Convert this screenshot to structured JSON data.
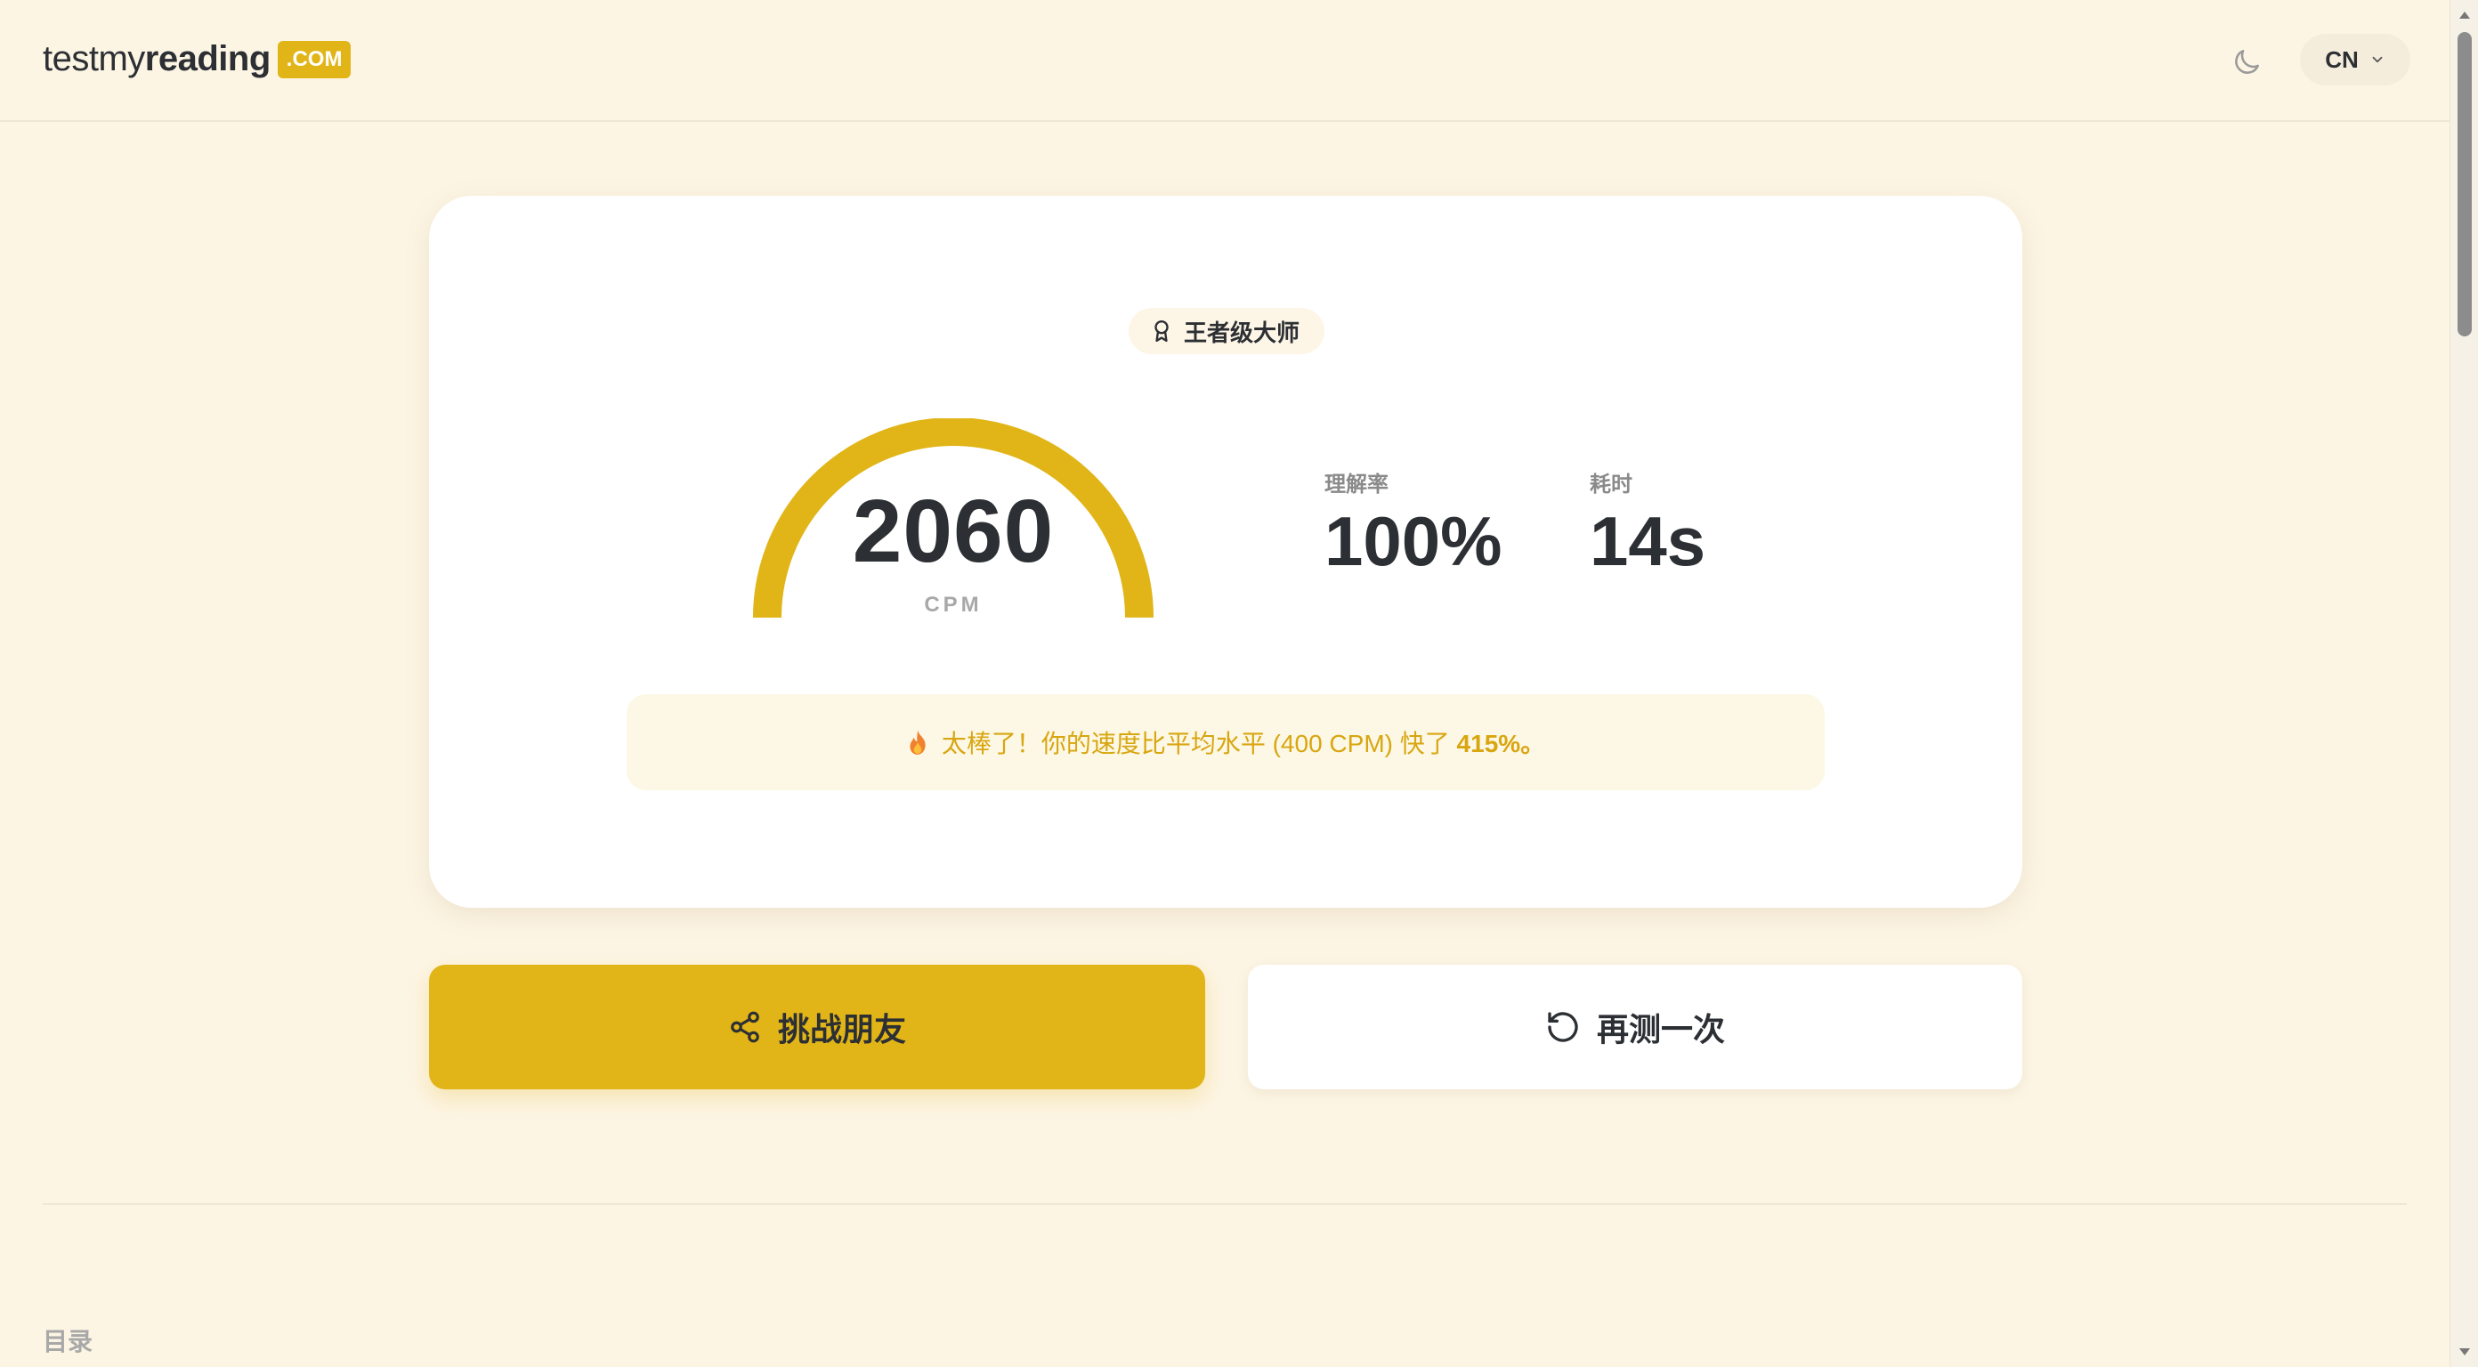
{
  "header": {
    "logo": {
      "part1": "testmy",
      "part2": "reading",
      "badge": ".COM"
    },
    "theme_icon": "moon-icon",
    "language": {
      "selected": "CN",
      "icon": "chevron-down-icon"
    }
  },
  "result": {
    "rank_icon": "award-icon",
    "rank": "王者级大师",
    "speed_value": "2060",
    "speed_unit": "CPM",
    "gauge_progress": 1.0,
    "comprehension": {
      "label": "理解率",
      "value": "100%"
    },
    "time": {
      "label": "耗时",
      "value": "14s"
    },
    "feedback": {
      "icon": "fire-icon",
      "text": "太棒了！你的速度比平均水平 (400 CPM) 快了 ",
      "percent": "415%。"
    }
  },
  "actions": {
    "challenge": {
      "icon": "share-icon",
      "label": "挑战朋友"
    },
    "retry": {
      "icon": "retry-icon",
      "label": "再测一次"
    }
  },
  "toc": {
    "label": "目录"
  },
  "colors": {
    "accent": "#e1b517",
    "background": "#fdf5e4",
    "card": "#ffffff",
    "feedback_text": "#d9a611"
  }
}
